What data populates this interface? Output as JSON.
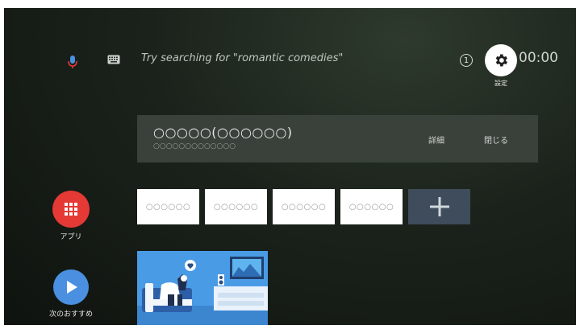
{
  "search": {
    "placeholder": "Try searching for \"romantic comedies\"",
    "mic_icon": "mic-icon",
    "keyboard_icon": "keyboard-icon"
  },
  "status": {
    "notification_count": "1",
    "settings_label": "設定",
    "clock": "00:00"
  },
  "notification": {
    "title": "○○○○○(○○○○○○)",
    "subtitle": "○○○○○○○○○○○○○",
    "details_label": "詳細",
    "close_label": "閉じる"
  },
  "apps": {
    "label": "アプリ",
    "tiles": [
      "○○○○○○",
      "○○○○○○",
      "○○○○○○",
      "○○○○○○"
    ],
    "add_icon": "plus-icon"
  },
  "recommendations": {
    "label": "次のおすすめ",
    "play_icon": "play-icon"
  },
  "colors": {
    "apps_button": "#e53935",
    "recommend_button": "#4a8fe0",
    "add_tile": "#3e4c5c",
    "background": "#1b221b"
  }
}
